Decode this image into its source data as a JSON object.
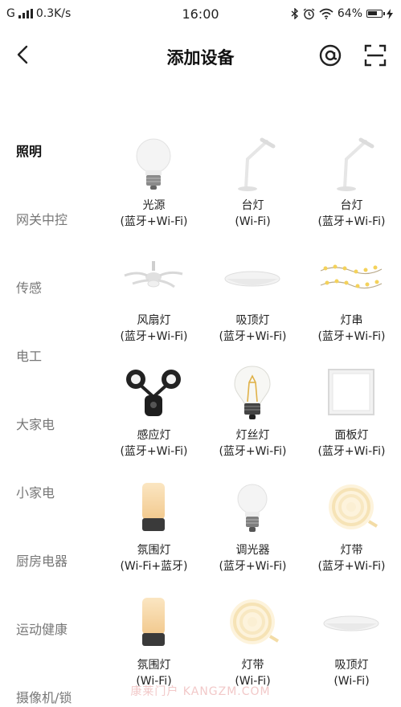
{
  "status_bar": {
    "network": "G",
    "speed": "0.3K/s",
    "time": "16:00",
    "battery": "64%",
    "icons": [
      "signal-icon",
      "bluetooth-icon",
      "alarm-icon",
      "wifi-icon",
      "battery-icon",
      "charging-icon"
    ]
  },
  "header": {
    "title": "添加设备",
    "back_icon": "chevron-left-icon",
    "at_icon": "at-sign-icon",
    "scan_icon": "scan-icon"
  },
  "categories": [
    {
      "label": "照明",
      "active": true
    },
    {
      "label": "网关中控",
      "active": false
    },
    {
      "label": "传感",
      "active": false
    },
    {
      "label": "电工",
      "active": false
    },
    {
      "label": "大家电",
      "active": false
    },
    {
      "label": "小家电",
      "active": false
    },
    {
      "label": "厨房电器",
      "active": false
    },
    {
      "label": "运动健康",
      "active": false
    },
    {
      "label": "摄像机/锁",
      "active": false
    }
  ],
  "devices": [
    {
      "name": "光源",
      "sub": "(蓝牙+Wi-Fi)",
      "icon": "bulb-icon"
    },
    {
      "name": "台灯",
      "sub": "(Wi-Fi)",
      "icon": "desk-lamp-icon"
    },
    {
      "name": "台灯",
      "sub": "(蓝牙+Wi-Fi)",
      "icon": "desk-lamp-icon"
    },
    {
      "name": "风扇灯",
      "sub": "(蓝牙+Wi-Fi)",
      "icon": "fan-light-icon"
    },
    {
      "name": "吸顶灯",
      "sub": "(蓝牙+Wi-Fi)",
      "icon": "ceiling-light-icon"
    },
    {
      "name": "灯串",
      "sub": "(蓝牙+Wi-Fi)",
      "icon": "string-lights-icon"
    },
    {
      "name": "感应灯",
      "sub": "(蓝牙+Wi-Fi)",
      "icon": "sensor-light-icon"
    },
    {
      "name": "灯丝灯",
      "sub": "(蓝牙+Wi-Fi)",
      "icon": "filament-bulb-icon"
    },
    {
      "name": "面板灯",
      "sub": "(蓝牙+Wi-Fi)",
      "icon": "panel-light-icon"
    },
    {
      "name": "氛围灯",
      "sub": "(Wi-Fi+蓝牙)",
      "icon": "ambient-lamp-icon"
    },
    {
      "name": "调光器",
      "sub": "(蓝牙+Wi-Fi)",
      "icon": "bulb-icon"
    },
    {
      "name": "灯带",
      "sub": "(蓝牙+Wi-Fi)",
      "icon": "light-strip-icon"
    },
    {
      "name": "氛围灯",
      "sub": "(Wi-Fi)",
      "icon": "ambient-lamp-icon"
    },
    {
      "name": "灯带",
      "sub": "(Wi-Fi)",
      "icon": "light-strip-icon"
    },
    {
      "name": "吸顶灯",
      "sub": "(Wi-Fi)",
      "icon": "ceiling-light-icon"
    }
  ],
  "watermark": "康莱门户 KANGZM.COM"
}
